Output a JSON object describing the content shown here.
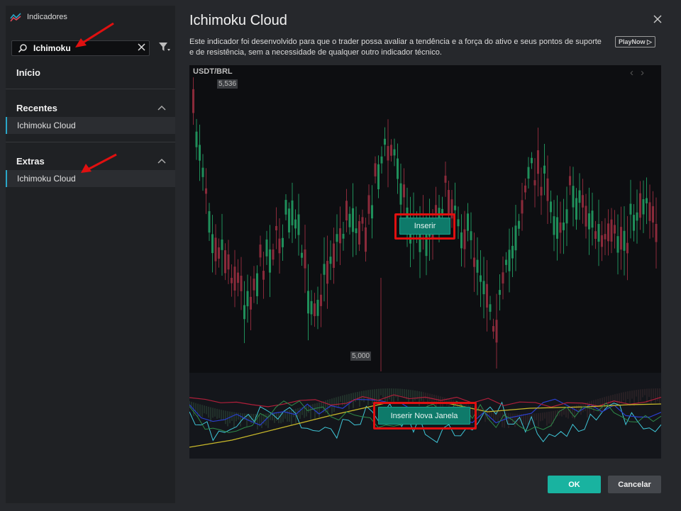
{
  "app": {
    "title": "Indicadores",
    "icon": "indicator-chart-icon"
  },
  "search": {
    "value": "Ichimoku",
    "placeholder": ""
  },
  "sidebar": {
    "home": "Início",
    "sections": [
      {
        "title": "Recentes",
        "items": [
          "Ichimoku Cloud"
        ]
      },
      {
        "title": "Extras",
        "items": [
          "Ichimoku Cloud"
        ]
      }
    ]
  },
  "main": {
    "title": "Ichimoku Cloud",
    "description": "Este indicador foi desenvolvido para que o trader possa avaliar a tendência e a força do ativo e seus pontos de suporte e de resistência, sem a necessidade de qualquer outro indicador técnico.",
    "playnow": "PlayNow ▷",
    "preview": {
      "pair": "USDT/BRL",
      "high_label": "5,536",
      "low_label": "5,000",
      "insert_label": "Inserir",
      "insert_new_window_label": "Inserir Nova Janela"
    }
  },
  "footer": {
    "ok_label": "OK",
    "cancel_label": "Cancelar"
  },
  "colors": {
    "accent": "#19b3a0",
    "highlight": "#e01010",
    "bull": "#1f8f5a",
    "bear": "#8a2a3a"
  }
}
